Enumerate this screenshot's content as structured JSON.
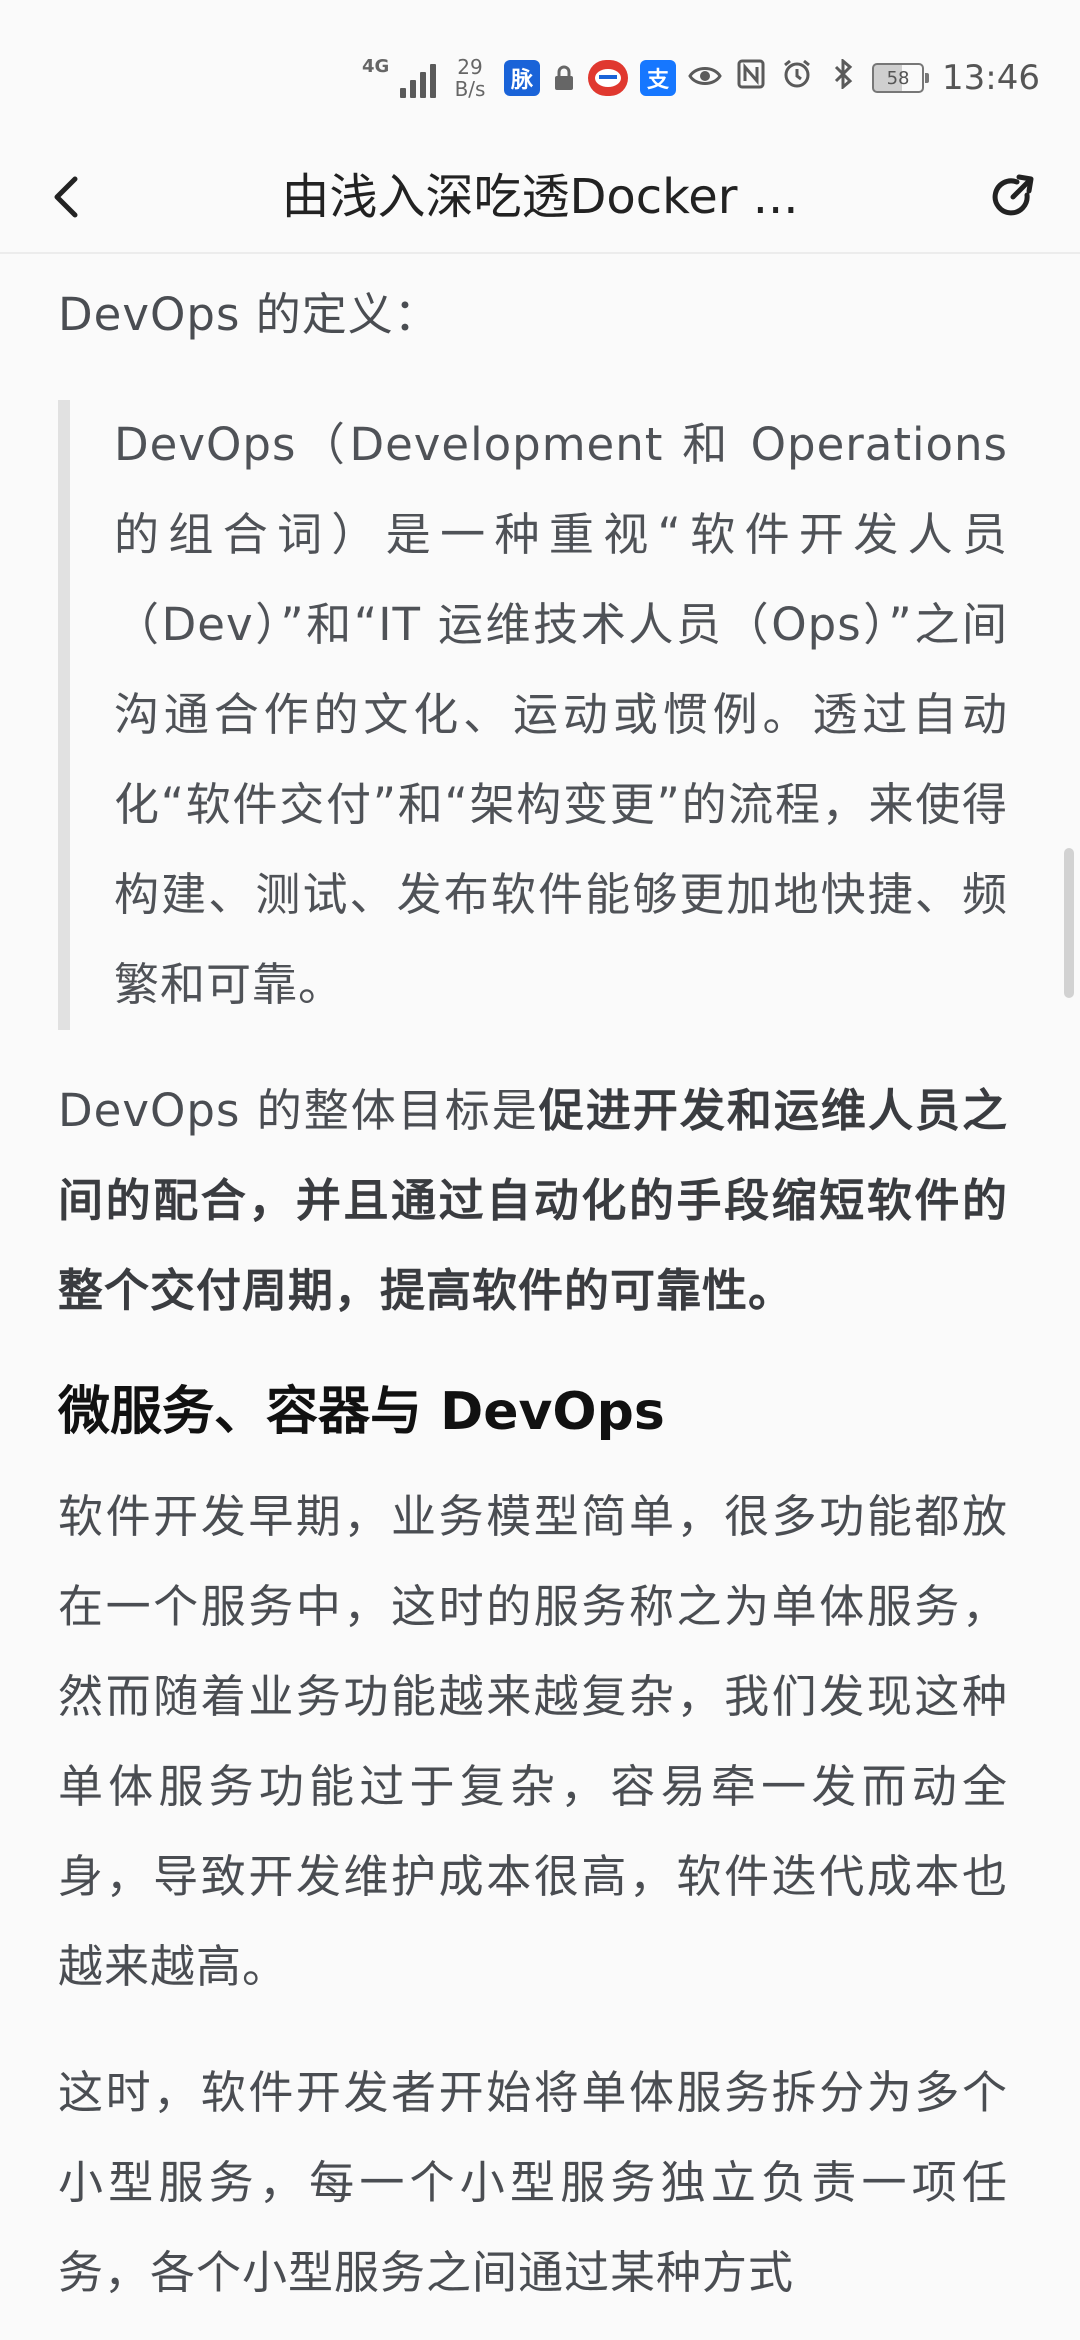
{
  "status_bar": {
    "network": "4G",
    "net_speed_value": "29",
    "net_speed_unit": "B/s",
    "apps": {
      "mai": "脉",
      "rail": "12306",
      "zhi": "支"
    },
    "battery": "58",
    "time": "13:46",
    "icons": [
      "signal-icon",
      "lock-icon",
      "eye-icon",
      "nfc-icon",
      "alarm-icon",
      "bluetooth-icon",
      "battery-icon"
    ]
  },
  "header": {
    "title": "由浅入深吃透Docker ...",
    "back_icon": "back-arrow-icon",
    "share_icon": "share-icon"
  },
  "article": {
    "devops_def_intro": "DevOps 的定义：",
    "devops_quote": "DevOps（Development 和 Operations 的组合词）是一种重视“软件开发人员（Dev）”和“IT 运维技术人员（Ops）”之间沟通合作的文化、运动或惯例。透过自动化“软件交付”和“架构变更”的流程，来使得构建、测试、发布软件能够更加地快捷、频繁和可靠。",
    "goal_prefix": "DevOps 的整体目标是",
    "goal_bold": "促进开发和运维人员之间的配合，并且通过自动化的手段缩短软件的整个交付周期，提高软件的可靠性。",
    "section_title": "微服务、容器与 DevOps",
    "para_microservice_1": "软件开发早期，业务模型简单，很多功能都放在一个服务中，这时的服务称之为单体服务，然而随着业务功能越来越复杂，我们发现这种单体服务功能过于复杂，容易牵一发而动全身，导致开发维护成本很高，软件迭代成本也越来越高。",
    "para_microservice_2": "这时，软件开发者开始将单体服务拆分为多个小型服务，每一个小型服务独立负责一项任务，各个小型服务之间通过某种方式"
  },
  "colors": {
    "background": "#fafafa",
    "text": "#4a4d52",
    "title": "#111111",
    "quote_border": "#e1e1e1"
  }
}
